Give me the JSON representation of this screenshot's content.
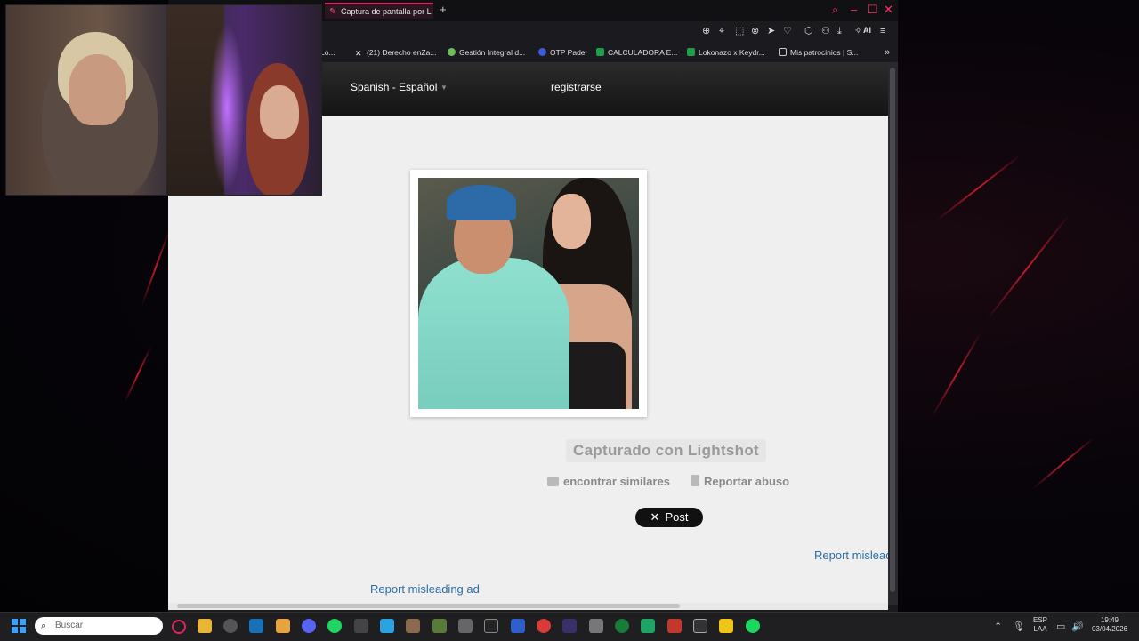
{
  "browser": {
    "tab_title": "Captura de pantalla por Li",
    "new_tab": "+",
    "toolbar_ai_label": "AI",
    "bookmarks": [
      {
        "label": "Lo..."
      },
      {
        "label": "(21) Derecho enZa..."
      },
      {
        "label": "Gestión Integral d..."
      },
      {
        "label": "OTP Padel"
      },
      {
        "label": "CALCULADORA E..."
      },
      {
        "label": "Lokonazo x Keydr..."
      },
      {
        "label": "Mis patrocinios | S..."
      }
    ],
    "more_bookmarks": "»"
  },
  "page": {
    "language_selector": "Spanish - Español",
    "register_link": "registrarse",
    "caption": "Capturado con Lightshot",
    "find_similar": "encontrar similares",
    "report_abuse": "Reportar abuso",
    "post_button": "Post",
    "report_ad_1": "Report mislead",
    "report_ad_2": "Report misleading ad"
  },
  "taskbar": {
    "search_placeholder": "Buscar",
    "language_line1": "ESP",
    "language_line2": "LAA",
    "time": "19:49",
    "date": "03/04/2026"
  },
  "colors": {
    "accent": "#e0245e",
    "link": "#2b6ea6",
    "page_bg": "#efefef"
  }
}
